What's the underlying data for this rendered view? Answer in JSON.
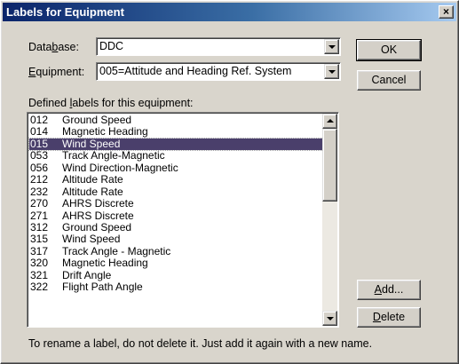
{
  "window": {
    "title": "Labels for Equipment",
    "close_glyph": "×"
  },
  "database": {
    "label_pre": "Data",
    "label_u": "b",
    "label_post": "ase:",
    "value": "DDC"
  },
  "equipment": {
    "label_u": "E",
    "label_post": "quipment:",
    "value": "005=Attitude and Heading Ref. System"
  },
  "list_label": {
    "pre": "Defined ",
    "u": "l",
    "post": "abels for this equipment:"
  },
  "labels": [
    {
      "code": "012",
      "name": "Ground Speed"
    },
    {
      "code": "014",
      "name": "Magnetic Heading"
    },
    {
      "code": "015",
      "name": "Wind Speed",
      "selected": true
    },
    {
      "code": "053",
      "name": "Track Angle-Magnetic"
    },
    {
      "code": "056",
      "name": "Wind Direction-Magnetic"
    },
    {
      "code": "212",
      "name": "Altitude Rate"
    },
    {
      "code": "232",
      "name": "Altitude Rate"
    },
    {
      "code": "270",
      "name": "AHRS Discrete"
    },
    {
      "code": "271",
      "name": "AHRS Discrete"
    },
    {
      "code": "312",
      "name": "Ground Speed"
    },
    {
      "code": "315",
      "name": "Wind Speed"
    },
    {
      "code": "317",
      "name": "Track Angle - Magnetic"
    },
    {
      "code": "320",
      "name": "Magnetic Heading"
    },
    {
      "code": "321",
      "name": "Drift Angle"
    },
    {
      "code": "322",
      "name": "Flight Path Angle"
    }
  ],
  "buttons": {
    "ok": "OK",
    "cancel": "Cancel",
    "add": {
      "u": "A",
      "post": "dd..."
    },
    "delete": {
      "u": "D",
      "post": "elete"
    }
  },
  "hint": "To rename a label, do not delete it.  Just add it again with a new name.",
  "colors": {
    "selection": "#4a3f6b",
    "titlebar_start": "#0a246a",
    "titlebar_end": "#a6caf0"
  }
}
